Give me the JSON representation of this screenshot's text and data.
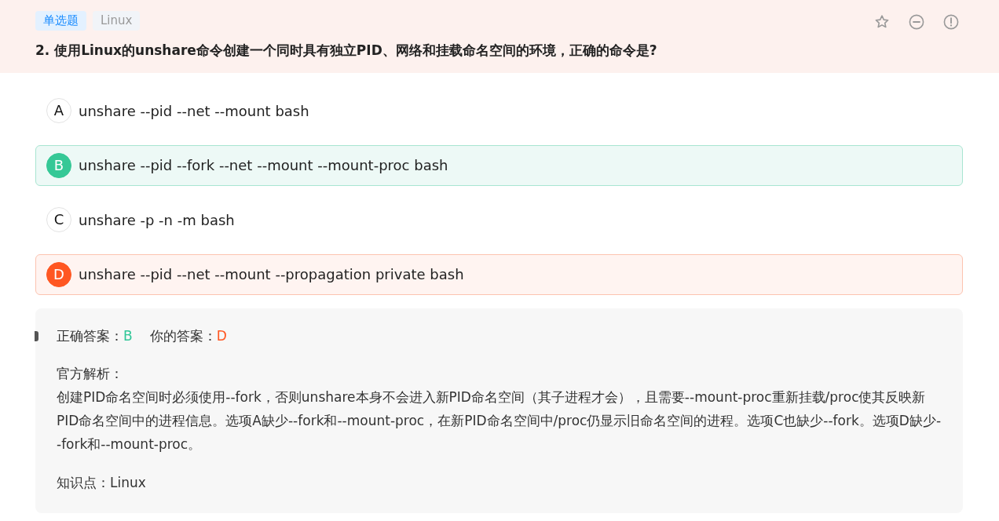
{
  "header": {
    "tags": [
      {
        "label": "单选题",
        "kind": "type"
      },
      {
        "label": "Linux",
        "kind": "topic"
      }
    ],
    "question": "2. 使用Linux的unshare命令创建一个同时具有独立PID、网络和挂载命名空间的环境，正确的命令是?"
  },
  "options": [
    {
      "letter": "A",
      "text": "unshare --pid --net --mount bash",
      "kind": "plain"
    },
    {
      "letter": "B",
      "text": "unshare --pid --fork --net --mount --mount-proc bash",
      "kind": "correct"
    },
    {
      "letter": "C",
      "text": "unshare -p -n -m bash",
      "kind": "plain"
    },
    {
      "letter": "D",
      "text": "unshare --pid --net --mount --propagation private bash",
      "kind": "wrong"
    }
  ],
  "analysis": {
    "correct_label": "正确答案：",
    "correct_value": "B",
    "your_label": "你的答案：",
    "your_value": "D",
    "explanation_title": "官方解析：",
    "explanation": "创建PID命名空间时必须使用--fork，否则unshare本身不会进入新PID命名空间（其子进程才会），且需要--mount-proc重新挂载/proc使其反映新PID命名空间中的进程信息。选项A缺少--fork和--mount-proc，在新PID命名空间中/proc仍显示旧命名空间的进程。选项C也缺少--fork。选项D缺少--fork和--mount-proc。",
    "knowledge_label": "知识点：",
    "knowledge_value": "Linux"
  }
}
